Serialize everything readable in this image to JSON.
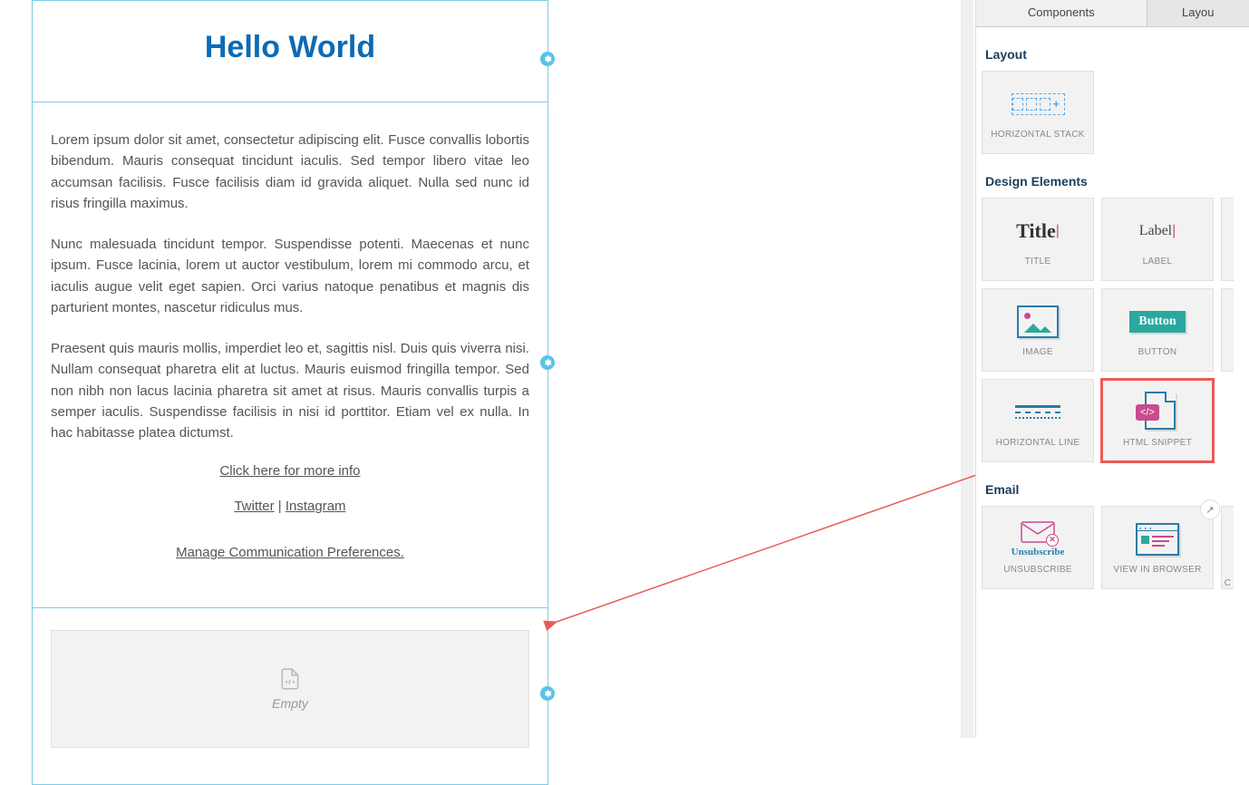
{
  "canvas": {
    "title": "Hello World",
    "para1": "Lorem ipsum dolor sit amet, consectetur adipiscing elit. Fusce convallis lobortis bibendum. Mauris consequat tincidunt iaculis. Sed tempor libero vitae leo accumsan facilisis. Fusce facilisis diam id gravida aliquet. Nulla sed nunc id risus fringilla maximus.",
    "para2": "Nunc malesuada tincidunt tempor. Suspendisse potenti. Maecenas et nunc ipsum. Fusce lacinia, lorem ut auctor vestibulum, lorem mi commodo arcu, et iaculis augue velit eget sapien. Orci varius natoque penatibus et magnis dis parturient montes, nascetur ridiculus mus.",
    "para3": "Praesent quis mauris mollis, imperdiet leo et, sagittis nisl. Duis quis viverra nisi. Nullam consequat pharetra elit at luctus. Mauris euismod fringilla tempor. Sed non nibh non lacus lacinia pharetra sit amet at risus. Mauris convallis turpis a semper iaculis. Suspendisse facilisis in nisi id porttitor. Etiam vel ex nulla. In hac habitasse platea dictumst.",
    "more_info": "Click here for more info",
    "twitter": "Twitter",
    "sep": " | ",
    "instagram": "Instagram",
    "manage": "Manage Communication Preferences.",
    "empty": "Empty"
  },
  "sidebar": {
    "tabs": {
      "components": "Components",
      "layout": "Layou"
    },
    "sections": {
      "layout": "Layout",
      "design": "Design Elements",
      "email": "Email"
    },
    "components": {
      "hstack": "HORIZONTAL STACK",
      "title": "TITLE",
      "title_preview": "Title",
      "label": "LABEL",
      "label_preview": "Label",
      "image": "IMAGE",
      "button": "BUTTON",
      "button_preview": "Button",
      "hline": "HORIZONTAL LINE",
      "snippet": "HTML SNIPPET",
      "unsubscribe": "UNSUBSCRIBE",
      "unsubscribe_preview": "Unsubscribe",
      "view_browser": "VIEW IN BROWSER",
      "c_partial": "C"
    }
  }
}
